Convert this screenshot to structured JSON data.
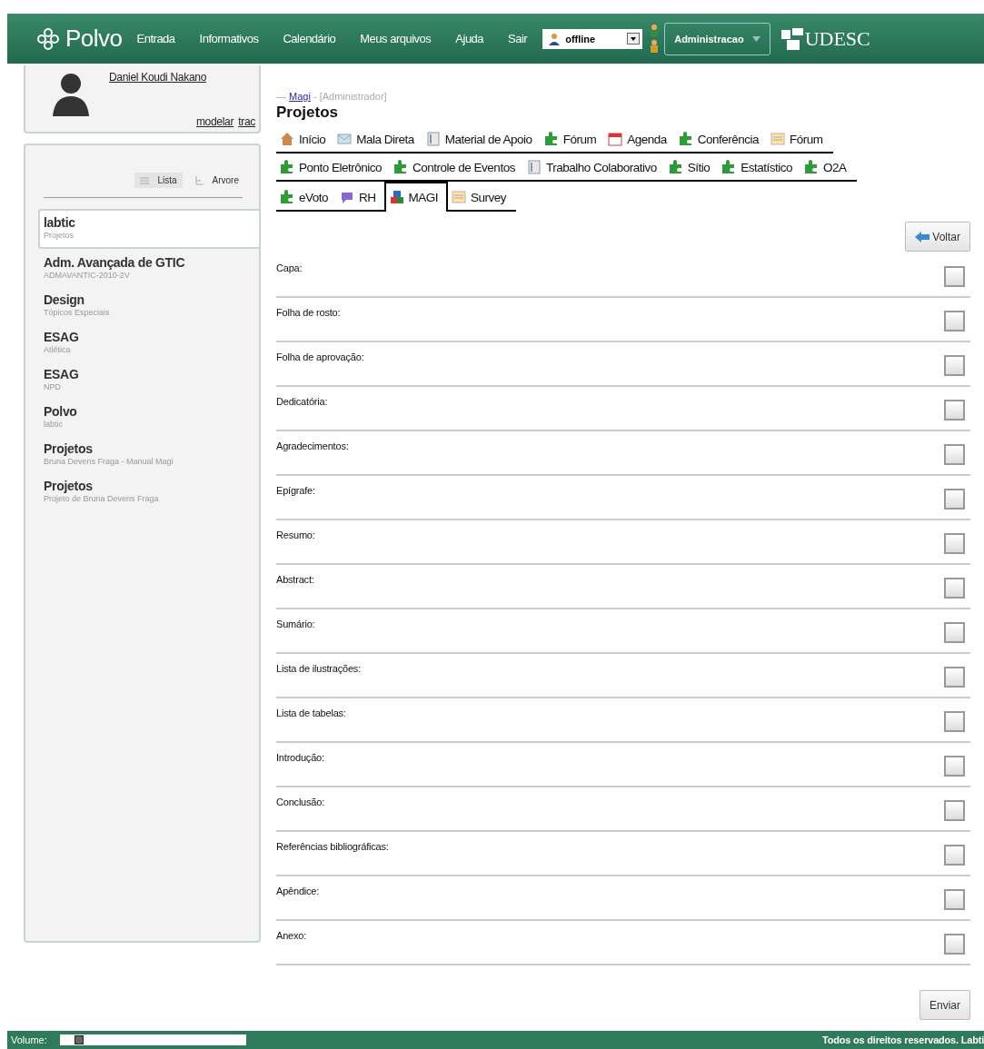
{
  "header": {
    "logo": "Polvo",
    "nav": [
      "Entrada",
      "Informativos",
      "Calendário",
      "Meus arquivos",
      "Ajuda",
      "Sair"
    ],
    "status": {
      "value": "offline"
    },
    "role_menu": {
      "label": "Administracao"
    },
    "institution": "UDESC"
  },
  "profile": {
    "name": "Daniel Koudi Nakano",
    "links": [
      "modelar",
      "trac"
    ]
  },
  "view_toggle": [
    {
      "label": "Lista",
      "selected": true
    },
    {
      "label": "Arvore",
      "selected": false
    }
  ],
  "groups": [
    {
      "title": "labtic",
      "subtitle": "Projetos",
      "selected": true
    },
    {
      "title": "Adm. Avançada de GTIC",
      "subtitle": "ADMAVANTIC-2010-2V",
      "selected": false
    },
    {
      "title": "Design",
      "subtitle": "Tópicos Especiais",
      "selected": false
    },
    {
      "title": "ESAG",
      "subtitle": "Atlética",
      "selected": false
    },
    {
      "title": "ESAG",
      "subtitle": "NPD",
      "selected": false
    },
    {
      "title": "Polvo",
      "subtitle": "labtic",
      "selected": false
    },
    {
      "title": "Projetos",
      "subtitle": "Bruna Devens Fraga - Manual Magi",
      "selected": false
    },
    {
      "title": "Projetos",
      "subtitle": "Projeto de Bruna Devens Fraga",
      "selected": false
    }
  ],
  "breadcrumb": {
    "prefix": "—",
    "link": "Magi",
    "suffix": "- [Administrador]"
  },
  "page_title": "Projetos",
  "tab_rows": [
    [
      {
        "label": "Início",
        "kind": "house",
        "selected": false
      },
      {
        "label": "Mala Direta",
        "kind": "mail",
        "selected": false
      },
      {
        "label": "Material de Apoio",
        "kind": "book",
        "selected": false
      },
      {
        "label": "Fórum",
        "kind": "puzzle",
        "selected": false
      },
      {
        "label": "Agenda",
        "kind": "calendar",
        "selected": false
      },
      {
        "label": "Conferência",
        "kind": "puzzle",
        "selected": false
      },
      {
        "label": "Fórum",
        "kind": "board",
        "selected": false
      }
    ],
    [
      {
        "label": "Ponto Eletrônico",
        "kind": "puzzle",
        "selected": false
      },
      {
        "label": "Controle de Eventos",
        "kind": "puzzle",
        "selected": false
      },
      {
        "label": "Trabalho Colaborativo",
        "kind": "book",
        "selected": false
      },
      {
        "label": "Sítio",
        "kind": "puzzle",
        "selected": false
      },
      {
        "label": "Estatístico",
        "kind": "puzzle",
        "selected": false
      },
      {
        "label": "O2A",
        "kind": "puzzle",
        "selected": false
      }
    ],
    [
      {
        "label": "eVoto",
        "kind": "puzzle",
        "selected": false
      },
      {
        "label": "RH",
        "kind": "bubble",
        "selected": false
      },
      {
        "label": "MAGI",
        "kind": "blocks",
        "selected": true
      },
      {
        "label": "Survey",
        "kind": "board",
        "selected": false
      }
    ]
  ],
  "back_button": "Voltar",
  "sections": [
    {
      "label": "Capa:",
      "checked": false
    },
    {
      "label": "Folha de rosto:",
      "checked": false
    },
    {
      "label": "Folha de aprovação:",
      "checked": false
    },
    {
      "label": "Dedicatória:",
      "checked": false
    },
    {
      "label": "Agradecimentos:",
      "checked": false
    },
    {
      "label": "Epígrafe:",
      "checked": false
    },
    {
      "label": "Resumo:",
      "checked": false
    },
    {
      "label": "Abstract:",
      "checked": false
    },
    {
      "label": "Sumário:",
      "checked": false
    },
    {
      "label": "Lista de ilustrações:",
      "checked": false
    },
    {
      "label": "Lista de tabelas:",
      "checked": false
    },
    {
      "label": "Introdução:",
      "checked": false
    },
    {
      "label": "Conclusão:",
      "checked": false
    },
    {
      "label": "Referências bibliográficas:",
      "checked": false
    },
    {
      "label": "Apêndice:",
      "checked": false
    },
    {
      "label": "Anexo:",
      "checked": false
    }
  ],
  "submit_button": "Enviar",
  "footer": {
    "volume_label": "Volume:",
    "volume": {
      "level": 0.08
    },
    "copyright": "Todos os direitos reservados. Labti"
  }
}
